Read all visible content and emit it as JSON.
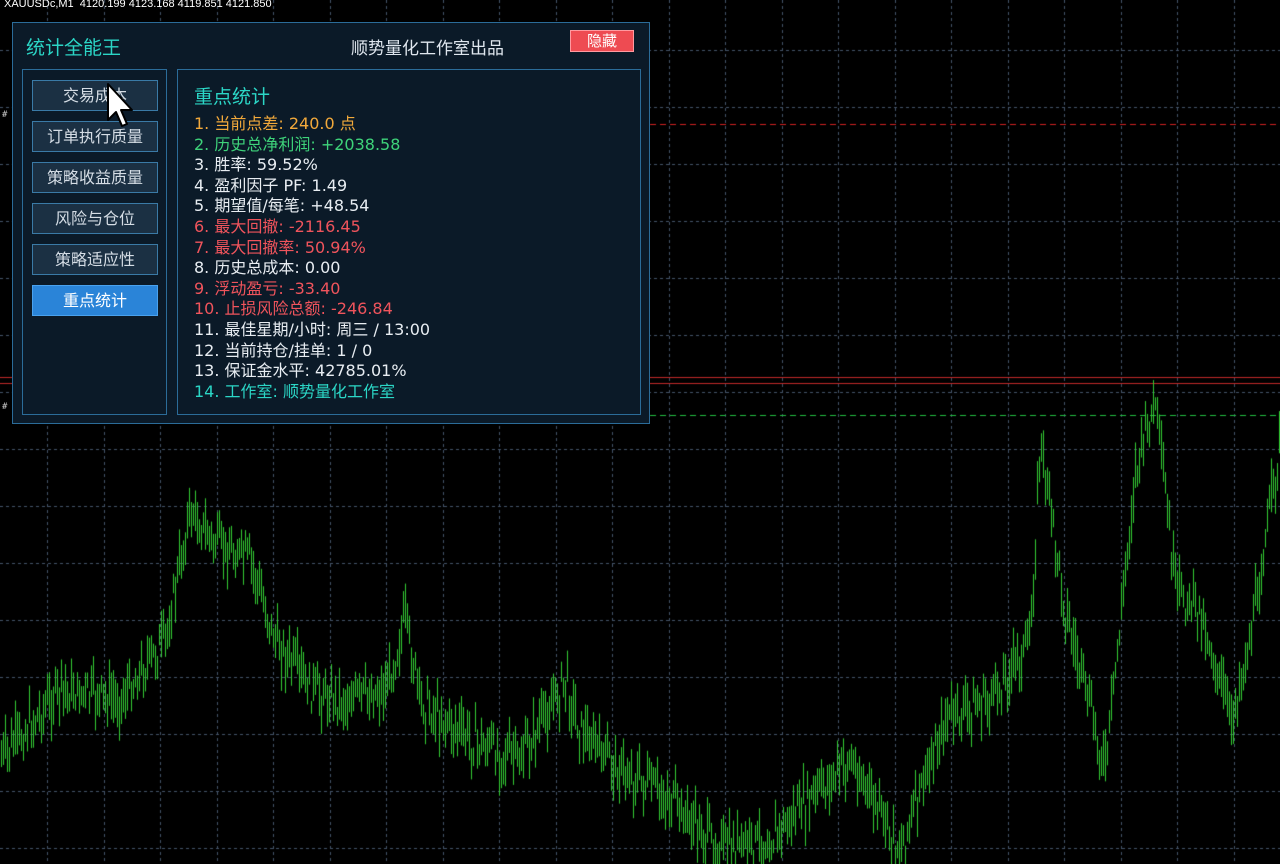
{
  "chart": {
    "symbol_header": "XAUUSDc,M1  4120.199 4123.168 4119.851 4121.850",
    "hash_marks": [
      "#",
      "#"
    ],
    "bar_color": "#33cc33",
    "grid_color": "#44546a",
    "line_red": "#d02020",
    "line_green": "#22c040"
  },
  "panel": {
    "title": "统计全能王",
    "credit": "顺势量化工作室出品",
    "hide_label": "隐藏",
    "nav": [
      {
        "label": "交易成本",
        "active": false
      },
      {
        "label": "订单执行质量",
        "active": false
      },
      {
        "label": "策略收益质量",
        "active": false
      },
      {
        "label": "风险与仓位",
        "active": false
      },
      {
        "label": "策略适应性",
        "active": false
      },
      {
        "label": "重点统计",
        "active": true
      }
    ],
    "content_title": "重点统计",
    "stats": [
      {
        "label": "1. 当前点差: ",
        "value": "240.0 点",
        "color": "orange"
      },
      {
        "label": "2. 历史总净利润: ",
        "value": "+2038.58",
        "color": "green"
      },
      {
        "label": "3. 胜率: ",
        "value": "59.52%",
        "color": "white"
      },
      {
        "label": "4. 盈利因子 PF: ",
        "value": "1.49",
        "color": "white"
      },
      {
        "label": "5. 期望值/每笔: ",
        "value": "+48.54",
        "color": "white"
      },
      {
        "label": "6. 最大回撤: ",
        "value": "-2116.45",
        "color": "red"
      },
      {
        "label": "7. 最大回撤率: ",
        "value": "50.94%",
        "color": "red"
      },
      {
        "label": "8. 历史总成本: ",
        "value": "0.00",
        "color": "white"
      },
      {
        "label": "9. 浮动盈亏: ",
        "value": "-33.40",
        "color": "red"
      },
      {
        "label": "10. 止损风险总额: ",
        "value": "-246.84",
        "color": "red"
      },
      {
        "label": "11. 最佳星期/小时: ",
        "value": "周三 / 13:00",
        "color": "white"
      },
      {
        "label": "12. 当前持仓/挂单: ",
        "value": "1 / 0",
        "color": "white"
      },
      {
        "label": "13. 保证金水平: ",
        "value": "42785.01%",
        "color": "white"
      },
      {
        "label": "14. 工作室: ",
        "value": "顺势量化工作室",
        "color": "cyan"
      }
    ]
  }
}
